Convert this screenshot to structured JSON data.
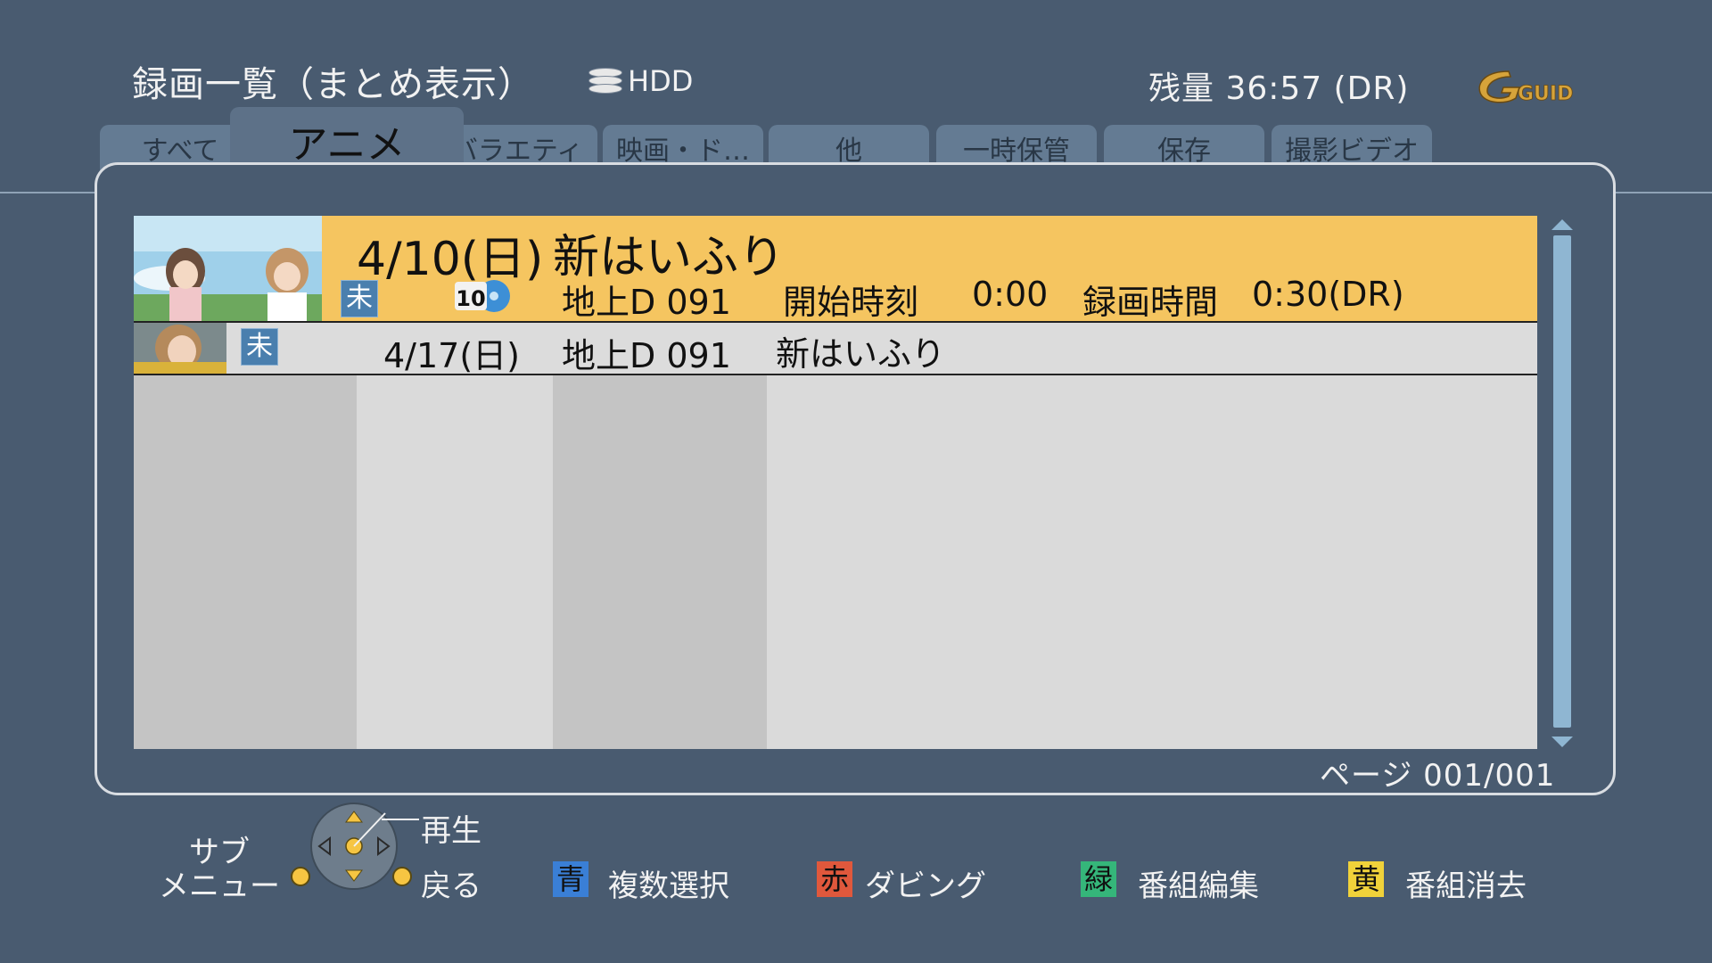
{
  "header": {
    "title": "録画一覧（まとめ表示）",
    "drive": "HDD",
    "remaining": "残量 36:57 (DR)",
    "logo_text": "GUIDE"
  },
  "tabs": [
    {
      "label": "すべて"
    },
    {
      "label": "アニメ",
      "active": true
    },
    {
      "label": "バラエティ"
    },
    {
      "label": "映画・ド…"
    },
    {
      "label": "他"
    },
    {
      "label": "一時保管"
    },
    {
      "label": "保存"
    },
    {
      "label": "撮影ビデオ"
    }
  ],
  "list": {
    "selected": {
      "date": "4/10(日)",
      "title": "新はいふり",
      "badge": "未",
      "count": "10",
      "channel": "地上D 091",
      "start_label": "開始時刻",
      "start_time": "0:00",
      "duration_label": "録画時間",
      "duration": "0:30(DR)"
    },
    "rows": [
      {
        "badge": "未",
        "date": "4/17(日)",
        "channel": "地上D 091",
        "title": "新はいふり"
      }
    ]
  },
  "page": {
    "label": "ページ",
    "value": "001/001"
  },
  "footer": {
    "submenu_line1": "サブ",
    "submenu_line2": "メニュー",
    "play": "再生",
    "back": "戻る",
    "blue_key": "青",
    "blue_label": "複数選択",
    "red_key": "赤",
    "red_label": "ダビング",
    "green_key": "緑",
    "green_label": "番組編集",
    "yellow_key": "黄",
    "yellow_label": "番組消去"
  },
  "colors": {
    "background": "#495b70",
    "selected_row": "#f5c560",
    "blue": "#3a7fd6",
    "red": "#e0583c",
    "green": "#35b67a",
    "yellow": "#f0d23a"
  }
}
